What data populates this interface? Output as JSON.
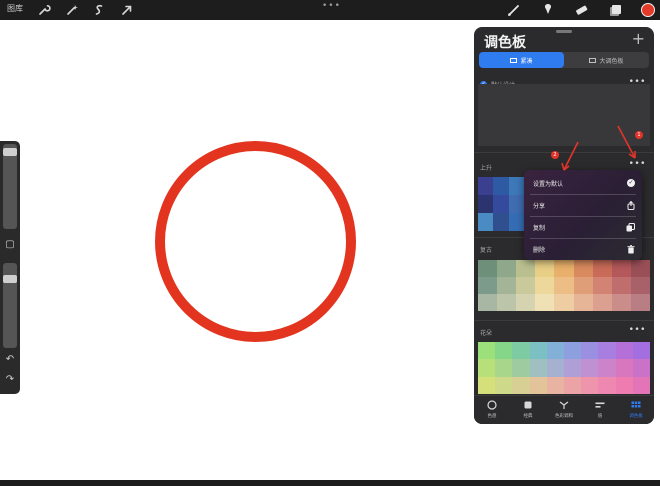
{
  "toolbar": {
    "gallery_label": "图库",
    "more_dots": "•••",
    "left_tools": [
      "wrench-icon",
      "magic-wand-icon",
      "selection-icon",
      "transform-arrow-icon"
    ],
    "right_tools": [
      "brush-icon",
      "smudge-icon",
      "eraser-icon",
      "layers-icon"
    ],
    "current_color": "#e33a2a"
  },
  "canvas": {
    "circle_color": "#e2341f",
    "background": "#ffffff"
  },
  "sidebar": {
    "undo": "↶",
    "redo": "↷",
    "brush_size_level": 0.95,
    "opacity_level": 0.85
  },
  "panel": {
    "title": "调色板",
    "plus": "+",
    "seg_compact": "紧凑",
    "seg_large": "大调色板",
    "default_palette_name": "默认设计",
    "palette1_name": "上升",
    "palette2_name": "复古",
    "palette3_name": "花朵",
    "dots": "•••"
  },
  "menu": {
    "items": [
      {
        "label": "设置为默认",
        "icon": "check-circle-icon"
      },
      {
        "label": "分享",
        "icon": "share-icon"
      },
      {
        "label": "复制",
        "icon": "duplicate-icon"
      },
      {
        "label": "删除",
        "icon": "trash-icon"
      }
    ]
  },
  "annotations": {
    "marker1": "1",
    "marker2": "2",
    "accent": "#e3342a"
  },
  "tabs": [
    {
      "label": "色盘",
      "icon": "disc-icon"
    },
    {
      "label": "经典",
      "icon": "square-icon"
    },
    {
      "label": "色彩调和",
      "icon": "harmony-icon"
    },
    {
      "label": "值",
      "icon": "sliders-icon"
    },
    {
      "label": "调色板",
      "icon": "palette-grid-icon"
    }
  ],
  "palette_colors": {
    "rising_partial": [
      "#3b3f8f",
      "#2d5aa3",
      "#3d78b8",
      "#2c3470",
      "#354a9c",
      "#3f6db0",
      "#4a8bc4",
      "#2f4f8f",
      "#356db5"
    ],
    "retro": [
      [
        "#6e8f7a",
        "#8fa88c",
        "#b9bf8f",
        "#e8cf86",
        "#e8b06a",
        "#d98a5e",
        "#c96b58",
        "#b4585b",
        "#9a4f57"
      ],
      [
        "#7d9b8a",
        "#a3b596",
        "#c9c99c",
        "#edd79a",
        "#ecbd84",
        "#df9d78",
        "#d28373",
        "#bf6e6d",
        "#a86168"
      ],
      [
        "#a7b7a3",
        "#bcc5a9",
        "#d6d3b0",
        "#f0e0b6",
        "#efcda3",
        "#e6b497",
        "#dca091",
        "#cb8d89",
        "#b97e84"
      ]
    ],
    "flowers": [
      [
        "#9be07a",
        "#86d68a",
        "#7ccba3",
        "#7cc0c3",
        "#83b0d6",
        "#8e9fe0",
        "#9a8fe0",
        "#a87fe0",
        "#b56fd9",
        "#a36fe0"
      ],
      [
        "#b8e07a",
        "#a8d68a",
        "#9ecba0",
        "#a0bfc0",
        "#a6b0cf",
        "#b09fd6",
        "#bf90d2",
        "#cc83c9",
        "#d877bd",
        "#c972c7"
      ],
      [
        "#d6e07a",
        "#cfd98a",
        "#d7cf93",
        "#e2c39a",
        "#e8b3a0",
        "#eca3a6",
        "#ee95ac",
        "#ef88b0",
        "#ee7cb1",
        "#e474b8"
      ]
    ]
  }
}
